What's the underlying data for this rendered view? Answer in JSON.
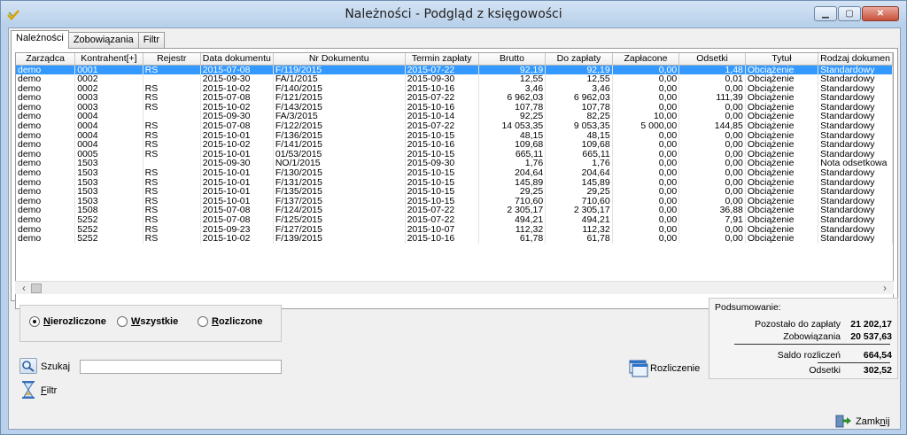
{
  "window": {
    "title": "Należności - Podgląd z księgowości",
    "buttons": {
      "minimize": "▁",
      "maximize": "▢",
      "close": "✕"
    }
  },
  "tabs": [
    {
      "label": "Należności",
      "active": true
    },
    {
      "label": "Zobowiązania",
      "active": false
    },
    {
      "label": "Filtr",
      "active": false
    }
  ],
  "table": {
    "columns": [
      "Zarządca",
      "Kontrahent[+]",
      "Rejestr",
      "Data dokumentu",
      "Nr Dokumentu",
      "Termin zapłaty",
      "Brutto",
      "Do zapłaty",
      "Zapłacone",
      "Odsetki",
      "Tytuł",
      "Rodzaj dokumen"
    ],
    "rows": [
      [
        "demo",
        "0001",
        "RS",
        "2015-07-08",
        "F/119/2015",
        "2015-07-22",
        "92,19",
        "92,19",
        "0,00",
        "1,48",
        "Obciążenie",
        "Standardowy"
      ],
      [
        "demo",
        "0002",
        "",
        "2015-09-30",
        "FA/1/2015",
        "2015-09-30",
        "12,55",
        "12,55",
        "0,00",
        "0,01",
        "Obciążenie",
        "Standardowy"
      ],
      [
        "demo",
        "0002",
        "RS",
        "2015-10-02",
        "F/140/2015",
        "2015-10-16",
        "3,46",
        "3,46",
        "0,00",
        "0,00",
        "Obciążenie",
        "Standardowy"
      ],
      [
        "demo",
        "0003",
        "RS",
        "2015-07-08",
        "F/121/2015",
        "2015-07-22",
        "6 962,03",
        "6 962,03",
        "0,00",
        "111,39",
        "Obciążenie",
        "Standardowy"
      ],
      [
        "demo",
        "0003",
        "RS",
        "2015-10-02",
        "F/143/2015",
        "2015-10-16",
        "107,78",
        "107,78",
        "0,00",
        "0,00",
        "Obciążenie",
        "Standardowy"
      ],
      [
        "demo",
        "0004",
        "",
        "2015-09-30",
        "FA/3/2015",
        "2015-10-14",
        "92,25",
        "82,25",
        "10,00",
        "0,00",
        "Obciążenie",
        "Standardowy"
      ],
      [
        "demo",
        "0004",
        "RS",
        "2015-07-08",
        "F/122/2015",
        "2015-07-22",
        "14 053,35",
        "9 053,35",
        "5 000,00",
        "144,85",
        "Obciążenie",
        "Standardowy"
      ],
      [
        "demo",
        "0004",
        "RS",
        "2015-10-01",
        "F/136/2015",
        "2015-10-15",
        "48,15",
        "48,15",
        "0,00",
        "0,00",
        "Obciążenie",
        "Standardowy"
      ],
      [
        "demo",
        "0004",
        "RS",
        "2015-10-02",
        "F/141/2015",
        "2015-10-16",
        "109,68",
        "109,68",
        "0,00",
        "0,00",
        "Obciążenie",
        "Standardowy"
      ],
      [
        "demo",
        "0005",
        "RS",
        "2015-10-01",
        "01/53/2015",
        "2015-10-15",
        "665,11",
        "665,11",
        "0,00",
        "0,00",
        "Obciążenie",
        "Standardowy"
      ],
      [
        "demo",
        "1503",
        "",
        "2015-09-30",
        "NO/1/2015",
        "2015-09-30",
        "1,76",
        "1,76",
        "0,00",
        "0,00",
        "Obciążenie",
        "Nota odsetkowa"
      ],
      [
        "demo",
        "1503",
        "RS",
        "2015-10-01",
        "F/130/2015",
        "2015-10-15",
        "204,64",
        "204,64",
        "0,00",
        "0,00",
        "Obciążenie",
        "Standardowy"
      ],
      [
        "demo",
        "1503",
        "RS",
        "2015-10-01",
        "F/131/2015",
        "2015-10-15",
        "145,89",
        "145,89",
        "0,00",
        "0,00",
        "Obciążenie",
        "Standardowy"
      ],
      [
        "demo",
        "1503",
        "RS",
        "2015-10-01",
        "F/135/2015",
        "2015-10-15",
        "29,25",
        "29,25",
        "0,00",
        "0,00",
        "Obciążenie",
        "Standardowy"
      ],
      [
        "demo",
        "1503",
        "RS",
        "2015-10-01",
        "F/137/2015",
        "2015-10-15",
        "710,60",
        "710,60",
        "0,00",
        "0,00",
        "Obciążenie",
        "Standardowy"
      ],
      [
        "demo",
        "1508",
        "RS",
        "2015-07-08",
        "F/124/2015",
        "2015-07-22",
        "2 305,17",
        "2 305,17",
        "0,00",
        "36,88",
        "Obciążenie",
        "Standardowy"
      ],
      [
        "demo",
        "5252",
        "RS",
        "2015-07-08",
        "F/125/2015",
        "2015-07-22",
        "494,21",
        "494,21",
        "0,00",
        "7,91",
        "Obciążenie",
        "Standardowy"
      ],
      [
        "demo",
        "5252",
        "RS",
        "2015-09-23",
        "F/127/2015",
        "2015-10-07",
        "112,32",
        "112,32",
        "0,00",
        "0,00",
        "Obciążenie",
        "Standardowy"
      ],
      [
        "demo",
        "5252",
        "RS",
        "2015-10-02",
        "F/139/2015",
        "2015-10-16",
        "61,78",
        "61,78",
        "0,00",
        "0,00",
        "Obciążenie",
        "Standardowy"
      ]
    ],
    "selected_row": 0
  },
  "filter": {
    "options": [
      {
        "pre": "",
        "key": "N",
        "post": "ierozliczone",
        "selected": true
      },
      {
        "pre": "",
        "key": "W",
        "post": "szystkie",
        "selected": false
      },
      {
        "pre": "",
        "key": "R",
        "post": "ozliczone",
        "selected": false
      }
    ]
  },
  "summary": {
    "title": "Podsumowanie:",
    "rows": [
      {
        "label": "Pozostało do zapłaty",
        "value": "21 202,17"
      },
      {
        "label": "Zobowiązania",
        "value": "20 537,63"
      },
      {
        "label": "Saldo rozliczeń",
        "value": "664,54"
      },
      {
        "label": "Odsetki",
        "value": "302,52"
      }
    ]
  },
  "search": {
    "label": "Szukaj",
    "value": ""
  },
  "filtr_button": {
    "key": "F",
    "rest": "iltr"
  },
  "rozliczenie_button": {
    "label": "Rozliczenie"
  },
  "zamknij_button": {
    "pre": "Zamk",
    "key": "n",
    "post": "ij"
  },
  "colors": {
    "selection": "#3399ff",
    "titlebar": "#c5d9ef",
    "client": "#f0f0f0"
  }
}
